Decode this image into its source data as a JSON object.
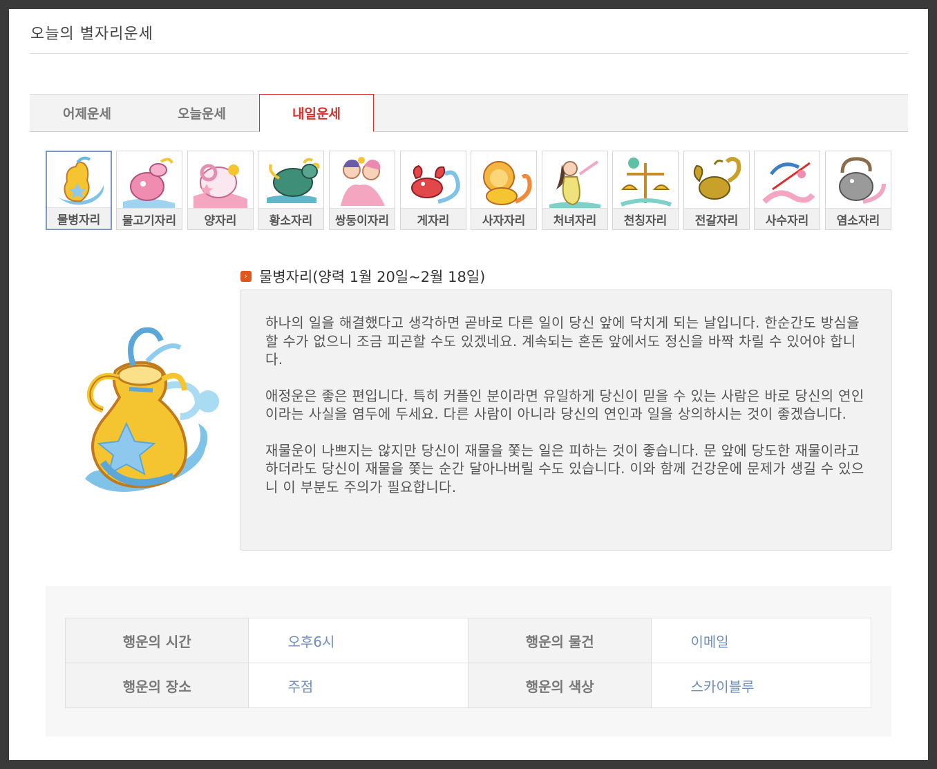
{
  "page": {
    "title": "오늘의 별자리운세"
  },
  "tabs": [
    {
      "label": "어제운세",
      "active": false
    },
    {
      "label": "오늘운세",
      "active": false
    },
    {
      "label": "내일운세",
      "active": true
    }
  ],
  "zodiac": [
    {
      "label": "물병자리",
      "icon": "aquarius-icon",
      "active": true
    },
    {
      "label": "물고기자리",
      "icon": "pisces-icon"
    },
    {
      "label": "양자리",
      "icon": "aries-icon"
    },
    {
      "label": "황소자리",
      "icon": "taurus-icon"
    },
    {
      "label": "쌍둥이자리",
      "icon": "gemini-icon"
    },
    {
      "label": "게자리",
      "icon": "cancer-icon"
    },
    {
      "label": "사자자리",
      "icon": "leo-icon"
    },
    {
      "label": "처녀자리",
      "icon": "virgo-icon"
    },
    {
      "label": "천칭자리",
      "icon": "libra-icon"
    },
    {
      "label": "전갈자리",
      "icon": "scorpio-icon"
    },
    {
      "label": "사수자리",
      "icon": "sagittarius-icon"
    },
    {
      "label": "염소자리",
      "icon": "capricorn-icon"
    }
  ],
  "sign": {
    "heading": "물병자리(양력 1월 20일~2월 18일)",
    "paragraphs": [
      "하나의 일을 해결했다고 생각하면 곧바로 다른 일이 당신 앞에 닥치게 되는 날입니다. 한순간도 방심을 할 수가 없으니 조금 피곤할 수도 있겠네요. 계속되는 혼돈 앞에서도 정신을 바짝 차릴 수 있어야 합니다.",
      "애정운은 좋은 편입니다. 특히 커플인 분이라면 유일하게 당신이 믿을 수 있는 사람은 바로 당신의 연인이라는 사실을 염두에 두세요. 다른 사람이 아니라 당신의 연인과 일을 상의하시는 것이 좋겠습니다.",
      "재물운이 나쁘지는 않지만 당신이 재물을 쫓는 일은 피하는 것이 좋습니다. 문 앞에 당도한 재물이라고 하더라도 당신이 재물을 쫓는 순간 달아나버릴 수도 있습니다. 이와 함께 건강운에 문제가 생길 수 있으니 이 부분도 주의가 필요합니다."
    ]
  },
  "lucky": {
    "time_label": "행운의 시간",
    "time": "오후6시",
    "item_label": "행운의 물건",
    "item": "이메일",
    "place_label": "행운의 장소",
    "place": "주점",
    "color_label": "행운의 색상",
    "color": "스카이블루"
  },
  "colors": {
    "accent": "#d9302c",
    "link": "#6e8fbd",
    "selected_border": "#7b98c4"
  }
}
